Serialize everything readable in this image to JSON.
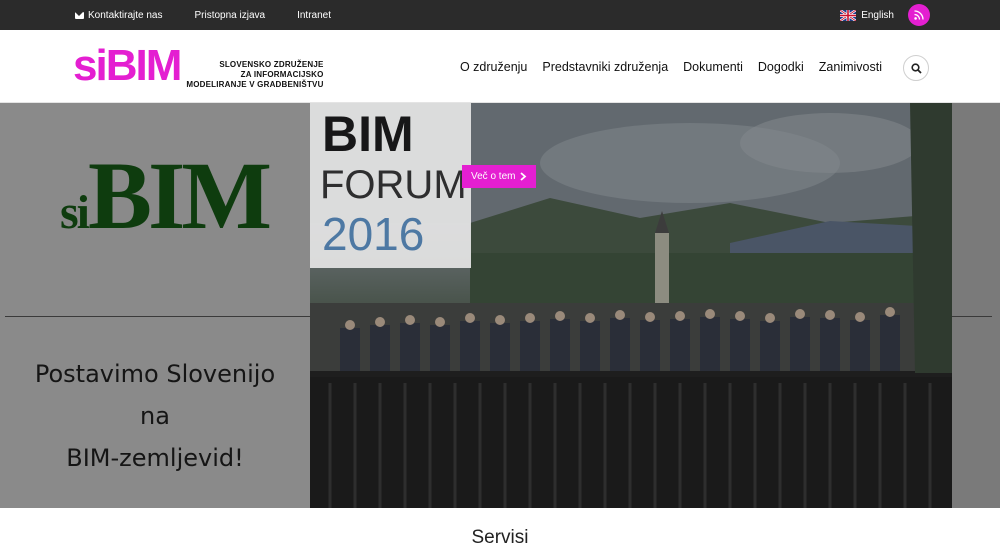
{
  "topbar": {
    "contact_label": "Kontaktirajte nas",
    "accessibility_label": "Pristopna izjava",
    "intranet_label": "Intranet",
    "language_label": "English"
  },
  "header": {
    "logo_word_si": "si",
    "logo_word_bim": "BIM",
    "logo_text_line1": "SLOVENSKO ZDRUŽENJE",
    "logo_text_line2": "ZA INFORMACIJSKO",
    "logo_text_line3": "MODELIRANJE V GRADBENIŠTVU",
    "nav": [
      {
        "label": "O združenju"
      },
      {
        "label": "Predstavniki združenja"
      },
      {
        "label": "Dokumenti"
      },
      {
        "label": "Dogodki"
      },
      {
        "label": "Zanimivosti"
      }
    ]
  },
  "hero": {
    "sibim_si": "si",
    "sibim_bim": "BIM",
    "slogan_line1": "Postavimo Slovenijo",
    "slogan_line2": "na",
    "slogan_line3": "BIM-zemljevid!",
    "forum_line1": "BIM",
    "forum_line2": "FORUM",
    "forum_line3": "2016",
    "cta_label": "Več o tem"
  },
  "services": {
    "title": "Servisi"
  },
  "colors": {
    "accent": "#e41fd1",
    "topbar": "#2b2b2b",
    "sibim_green": "#0e3c0e"
  }
}
